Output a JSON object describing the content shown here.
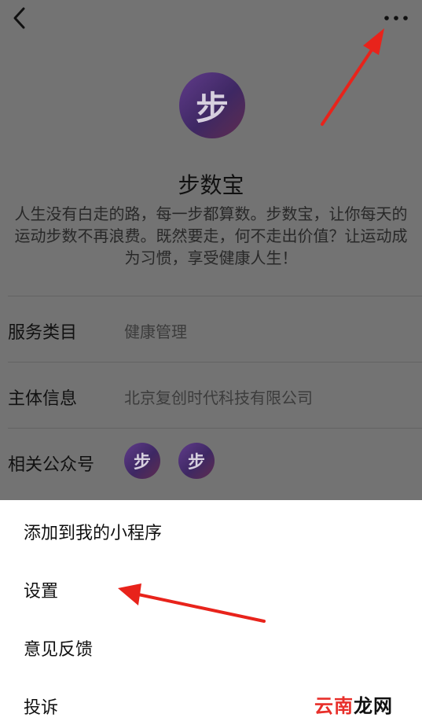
{
  "app": {
    "name": "步数宝",
    "logo_char": "步",
    "description": "人生没有白走的路，每一步都算数。步数宝，让你每天的运动步数不再浪费。既然要走，何不走出价值？让运动成为习惯，享受健康人生！"
  },
  "info": {
    "service_category_label": "服务类目",
    "service_category_value": "健康管理",
    "entity_label": "主体信息",
    "entity_value": "北京复创时代科技有限公司",
    "related_accounts_label": "相关公众号",
    "related_account_chars": [
      "步",
      "步"
    ]
  },
  "action_sheet": {
    "items": [
      "添加到我的小程序",
      "设置",
      "意见反馈",
      "投诉"
    ]
  },
  "watermark": {
    "part1": "云南",
    "part2": "龙网"
  },
  "colors": {
    "annotation_arrow": "#e8231b",
    "logo_start": "#603b8a",
    "logo_end": "#3e2863"
  },
  "icons": [
    "back-chevron-icon",
    "more-dots-icon"
  ]
}
